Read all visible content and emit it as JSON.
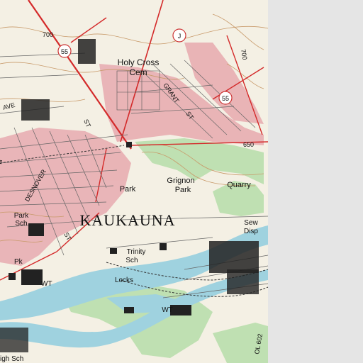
{
  "map": {
    "town_label": "KAUKAUNA",
    "contours": [
      "700",
      "700",
      "650"
    ],
    "routes": [
      "55",
      "55",
      "J"
    ],
    "streets": [
      "AVE",
      "ST",
      "GRANT",
      "ST",
      "DESNOVER",
      "ST"
    ],
    "places": {
      "cemetery_line1": "Holy Cross",
      "cemetery_line2": "Cem",
      "park_line1": "Grignon",
      "park_line2": "Park",
      "park_small": "Park",
      "quarry": "Quarry",
      "sew_line1": "Sew",
      "sew_line2": "Disp",
      "park_sch_line1": "Park",
      "park_sch_line2": "Sch",
      "trinity_line1": "Trinity",
      "trinity_line2": "Sch",
      "pk": "Pk",
      "wt_left": "WT",
      "locks": "Locks",
      "wt_bottom": "WT",
      "high_sch": "igh Sch",
      "route_bottom": "OL 602",
      "edge_n": "N"
    }
  }
}
